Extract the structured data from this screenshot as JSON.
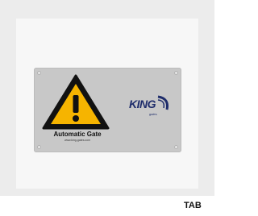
{
  "product": {
    "sign_title": "Automatic Gate",
    "sign_url": "www.king-gates.com",
    "brand_name": "KING",
    "brand_sub": "gates",
    "tab_label": "TAB"
  },
  "colors": {
    "warning_yellow": "#f6b400",
    "warning_black": "#111111",
    "plate_grey": "#c8c8c8",
    "brand_blue": "#1f2d6b"
  },
  "icons": {
    "warning": "warning-triangle-icon",
    "logo": "king-gates-logo"
  }
}
